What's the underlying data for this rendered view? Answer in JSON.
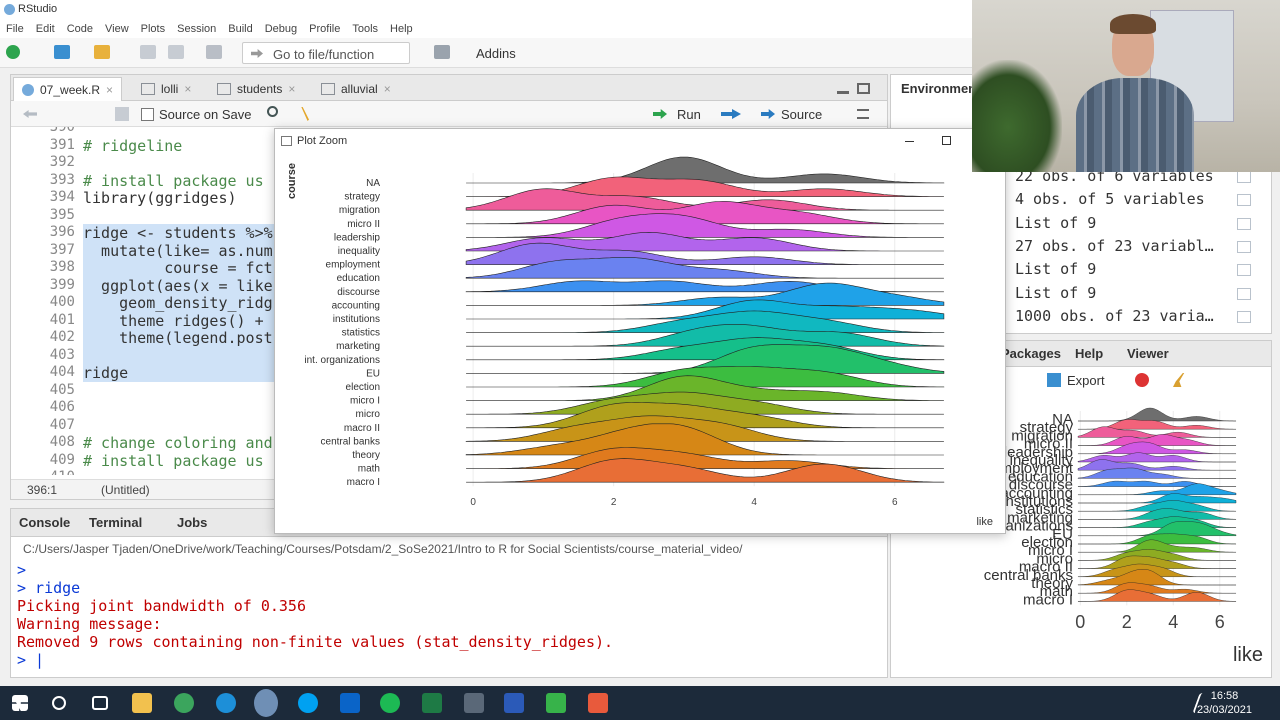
{
  "window": {
    "title": "RStudio"
  },
  "menu": [
    "File",
    "Edit",
    "Code",
    "View",
    "Plots",
    "Session",
    "Build",
    "Debug",
    "Profile",
    "Tools",
    "Help"
  ],
  "toolbar": {
    "goto_placeholder": "Go to file/function",
    "addins": "Addins"
  },
  "source_tabs": [
    {
      "label": "07_week.R",
      "active": true
    },
    {
      "label": "lolli",
      "active": false
    },
    {
      "label": "students",
      "active": false
    },
    {
      "label": "alluvial",
      "active": false
    }
  ],
  "source_toolbar": {
    "source_on_save": "Source on Save",
    "run": "Run",
    "source": "Source"
  },
  "editor": {
    "lines": [
      {
        "n": "390",
        "code": "",
        "hl": false,
        "comment": false
      },
      {
        "n": "391",
        "code": "# ridgeline",
        "hl": false,
        "comment": true
      },
      {
        "n": "392",
        "code": "",
        "hl": false,
        "comment": false
      },
      {
        "n": "393",
        "code": "# install package us",
        "hl": false,
        "comment": true
      },
      {
        "n": "394",
        "code": "library(ggridges)",
        "hl": false,
        "comment": false
      },
      {
        "n": "395",
        "code": "",
        "hl": false,
        "comment": false
      },
      {
        "n": "396",
        "code": "ridge <- students %>%",
        "hl": true,
        "comment": false
      },
      {
        "n": "397",
        "code": "  mutate(like= as.num",
        "hl": true,
        "comment": false
      },
      {
        "n": "398",
        "code": "         course = fct",
        "hl": true,
        "comment": false
      },
      {
        "n": "399",
        "code": "  ggplot(aes(x = like",
        "hl": true,
        "comment": false
      },
      {
        "n": "400",
        "code": "    geom_density_ridg",
        "hl": true,
        "comment": false
      },
      {
        "n": "401",
        "code": "    theme_ridges() +",
        "hl": true,
        "comment": false
      },
      {
        "n": "402",
        "code": "    theme(legend.post",
        "hl": true,
        "comment": false
      },
      {
        "n": "403",
        "code": "",
        "hl": true,
        "comment": false
      },
      {
        "n": "404",
        "code": "ridge",
        "hl": true,
        "comment": false
      },
      {
        "n": "405",
        "code": "",
        "hl": false,
        "comment": false
      },
      {
        "n": "406",
        "code": "",
        "hl": false,
        "comment": false
      },
      {
        "n": "407",
        "code": "",
        "hl": false,
        "comment": false
      },
      {
        "n": "408",
        "code": "# change coloring and",
        "hl": false,
        "comment": true
      },
      {
        "n": "409",
        "code": "# install package us",
        "hl": false,
        "comment": true
      },
      {
        "n": "410",
        "code": "",
        "hl": false,
        "comment": false
      }
    ],
    "position": "396:1",
    "scope": "(Untitled)"
  },
  "console_tabs": [
    "Console",
    "Terminal",
    "Jobs"
  ],
  "console": {
    "path": "C:/Users/Jasper Tjaden/OneDrive/work/Teaching/Courses/Potsdam/2_SoSe2021/Intro to R for Social Scientists/course_material_video/",
    "lines": [
      {
        "text": ">",
        "cls": "blue"
      },
      {
        "text": "> ridge",
        "cls": "blue"
      },
      {
        "text": "Picking joint bandwidth of 0.356",
        "cls": "red"
      },
      {
        "text": "Warning message:",
        "cls": "red"
      },
      {
        "text": "Removed 9 rows containing non-finite values (stat_density_ridges).",
        "cls": "red"
      },
      {
        "text": "> |",
        "cls": "blue"
      }
    ]
  },
  "environment": {
    "tab": "Environmen",
    "rows": [
      "22 obs. of 6 variables",
      "4 obs. of 5 variables",
      "List of 9",
      "27 obs. of 23 variabl…",
      "List of 9",
      "List of 9",
      "1000 obs. of 23 varia…"
    ]
  },
  "files_tabs": [
    "Packages",
    "Help",
    "Viewer"
  ],
  "files_toolbar": {
    "export": "Export"
  },
  "plot_zoom": {
    "title": "Plot Zoom"
  },
  "colors": {
    "accent": "#1e6fb8",
    "taskbar": "#1c2a3a",
    "selection": "#cfe2f7"
  },
  "chart_data": {
    "type": "ridgeline",
    "xlabel": "like",
    "ylabel": "course",
    "xlim": [
      -0.4,
      7
    ],
    "xticks": [
      0,
      2,
      4,
      6
    ],
    "categories": [
      "NA",
      "strategy",
      "migration",
      "micro II",
      "leadership",
      "inequality",
      "employment",
      "education",
      "discourse",
      "accounting",
      "institutions",
      "statistics",
      "marketing",
      "int. organizations",
      "EU",
      "election",
      "micro I",
      "micro",
      "macro II",
      "central banks",
      "theory",
      "math",
      "macro I"
    ],
    "peaks": [
      [
        [
          3,
          1.0
        ],
        [
          5,
          0.35
        ]
      ],
      [
        [
          2,
          0.7
        ],
        [
          3.2,
          0.6
        ],
        [
          5,
          0.3
        ]
      ],
      [
        [
          1,
          0.8
        ],
        [
          2.3,
          0.5
        ],
        [
          4.2,
          0.4
        ]
      ],
      [
        [
          2,
          0.7
        ],
        [
          3.5,
          0.8
        ],
        [
          4.6,
          0.4
        ]
      ],
      [
        [
          2.1,
          0.6
        ],
        [
          3,
          0.7
        ],
        [
          4.5,
          0.3
        ]
      ],
      [
        [
          1,
          0.5
        ],
        [
          2.5,
          0.7
        ],
        [
          4,
          0.5
        ]
      ],
      [
        [
          0.9,
          0.8
        ],
        [
          2.2,
          0.5
        ],
        [
          4,
          0.3
        ]
      ],
      [
        [
          1.2,
          0.6
        ],
        [
          2.3,
          0.7
        ],
        [
          3.5,
          0.3
        ]
      ],
      [
        [
          1.5,
          0.4
        ],
        [
          2.8,
          0.4
        ],
        [
          4.5,
          0.4
        ]
      ],
      [
        [
          3.5,
          0.3
        ],
        [
          5,
          0.8
        ],
        [
          6,
          0.3
        ]
      ],
      [
        [
          4,
          0.7
        ],
        [
          5.2,
          0.4
        ],
        [
          6.2,
          0.3
        ]
      ],
      [
        [
          3,
          0.4
        ],
        [
          4,
          0.7
        ],
        [
          5,
          0.4
        ]
      ],
      [
        [
          3.2,
          0.5
        ],
        [
          4,
          0.6
        ],
        [
          5.2,
          0.5
        ]
      ],
      [
        [
          3,
          0.4
        ],
        [
          4,
          0.7
        ],
        [
          5,
          0.5
        ]
      ],
      [
        [
          4,
          0.9
        ],
        [
          5,
          0.8
        ],
        [
          5.8,
          0.3
        ]
      ],
      [
        [
          3,
          0.6
        ],
        [
          4,
          0.6
        ],
        [
          5,
          0.5
        ]
      ],
      [
        [
          3,
          0.9
        ],
        [
          4,
          0.3
        ],
        [
          5,
          0.3
        ]
      ],
      [
        [
          2,
          0.5
        ],
        [
          3,
          0.7
        ],
        [
          4,
          0.4
        ]
      ],
      [
        [
          2,
          0.8
        ],
        [
          3,
          0.7
        ],
        [
          4,
          0.4
        ]
      ],
      [
        [
          1.5,
          0.5
        ],
        [
          2.5,
          0.8
        ],
        [
          3.5,
          0.6
        ]
      ],
      [
        [
          1.2,
          0.3
        ],
        [
          2.2,
          0.7
        ],
        [
          3,
          0.9
        ]
      ],
      [
        [
          2,
          0.7
        ],
        [
          3,
          0.5
        ],
        [
          4.5,
          0.3
        ]
      ],
      [
        [
          2,
          0.8
        ],
        [
          3,
          0.5
        ],
        [
          5,
          0.7
        ]
      ]
    ],
    "colors": [
      "#6e6e6e",
      "#f2627a",
      "#ee5c9a",
      "#e855c4",
      "#cf58e4",
      "#b264ec",
      "#8e72ee",
      "#6a82f0",
      "#3c90f0",
      "#1fa2e8",
      "#0fb0d8",
      "#10b8c0",
      "#12bca8",
      "#15bf8a",
      "#22c06a",
      "#3cbd40",
      "#6ab52a",
      "#8eab22",
      "#b0a01c",
      "#c89418",
      "#d68716",
      "#e07a1e",
      "#e86e36"
    ]
  },
  "taskbar": {
    "time": "16:58",
    "date": "23/03/2021"
  }
}
